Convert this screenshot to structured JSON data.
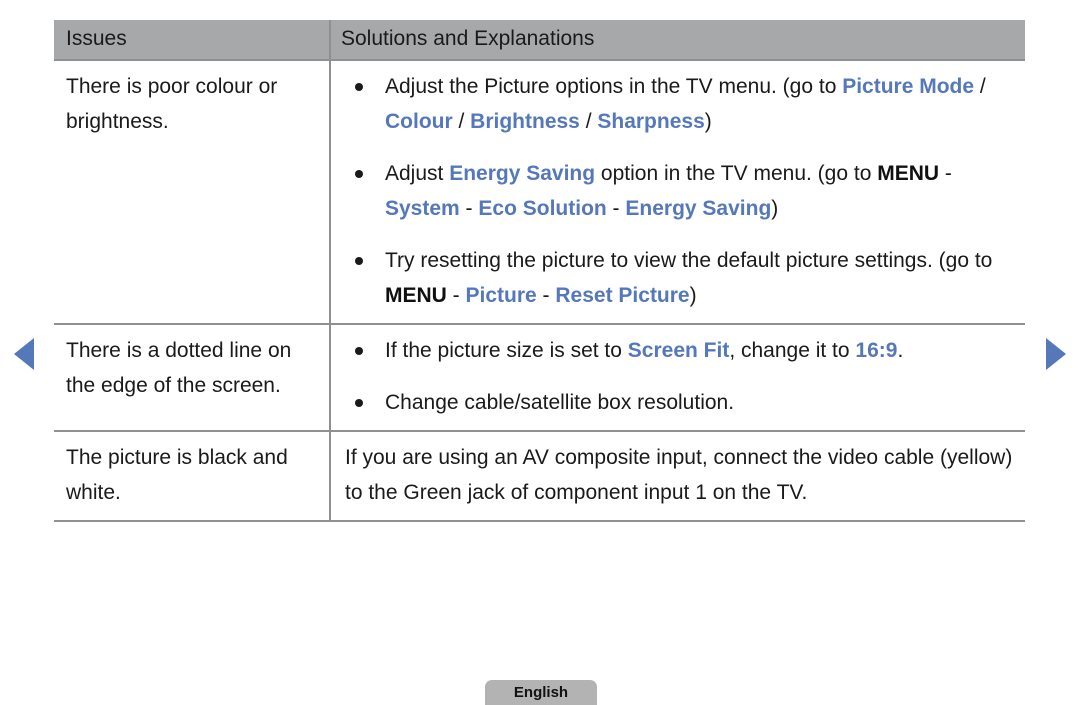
{
  "nav": {
    "prev_label": "previous page",
    "next_label": "next page",
    "arrow_color": "#5578ba"
  },
  "table": {
    "headers": {
      "issues": "Issues",
      "solutions": "Solutions and Explanations"
    },
    "rows": [
      {
        "issue": "There is poor colour or brightness.",
        "bullets": [
          {
            "segments": [
              {
                "text": "Adjust the Picture options in the TV menu. (go to ",
                "style": "normal"
              },
              {
                "text": "Picture Mode",
                "style": "blue"
              },
              {
                "text": " / ",
                "style": "normal"
              },
              {
                "text": "Colour",
                "style": "blue"
              },
              {
                "text": " / ",
                "style": "normal"
              },
              {
                "text": "Brightness",
                "style": "blue"
              },
              {
                "text": " / ",
                "style": "normal"
              },
              {
                "text": "Sharpness",
                "style": "blue"
              },
              {
                "text": ")",
                "style": "normal"
              }
            ]
          },
          {
            "segments": [
              {
                "text": "Adjust ",
                "style": "normal"
              },
              {
                "text": "Energy Saving",
                "style": "blue"
              },
              {
                "text": " option in the TV menu. (go to ",
                "style": "normal"
              },
              {
                "text": "MENU",
                "style": "bold"
              },
              {
                "text": " - ",
                "style": "normal"
              },
              {
                "text": "System",
                "style": "blue"
              },
              {
                "text": " - ",
                "style": "normal"
              },
              {
                "text": "Eco Solution",
                "style": "blue"
              },
              {
                "text": " - ",
                "style": "normal"
              },
              {
                "text": "Energy Saving",
                "style": "blue"
              },
              {
                "text": ")",
                "style": "normal"
              }
            ]
          },
          {
            "segments": [
              {
                "text": "Try resetting the picture to view the default picture settings. (go to ",
                "style": "normal"
              },
              {
                "text": "MENU",
                "style": "bold"
              },
              {
                "text": " - ",
                "style": "normal"
              },
              {
                "text": "Picture",
                "style": "blue"
              },
              {
                "text": " - ",
                "style": "normal"
              },
              {
                "text": "Reset Picture",
                "style": "blue"
              },
              {
                "text": ")",
                "style": "normal"
              }
            ]
          }
        ]
      },
      {
        "issue": "There is a dotted line on the edge of the screen.",
        "bullets": [
          {
            "segments": [
              {
                "text": "If the picture size is set to ",
                "style": "normal"
              },
              {
                "text": "Screen Fit",
                "style": "blue"
              },
              {
                "text": ", change it to ",
                "style": "normal"
              },
              {
                "text": "16:9",
                "style": "blue"
              },
              {
                "text": ".",
                "style": "normal"
              }
            ]
          },
          {
            "segments": [
              {
                "text": "Change cable/satellite box resolution.",
                "style": "normal"
              }
            ]
          }
        ]
      },
      {
        "issue": "The picture is black and white.",
        "paragraphs": [
          {
            "segments": [
              {
                "text": "If you are using an AV composite input, connect the video cable (yellow) to the Green jack of component input 1 on the TV.",
                "style": "normal"
              }
            ]
          }
        ]
      }
    ]
  },
  "footer": {
    "language_label": "English"
  },
  "colors": {
    "menu_blue": "#5578ba",
    "header_gray": "#a6a8aa",
    "border_gray": "#8e9092",
    "button_gray": "#b3b3b3"
  }
}
